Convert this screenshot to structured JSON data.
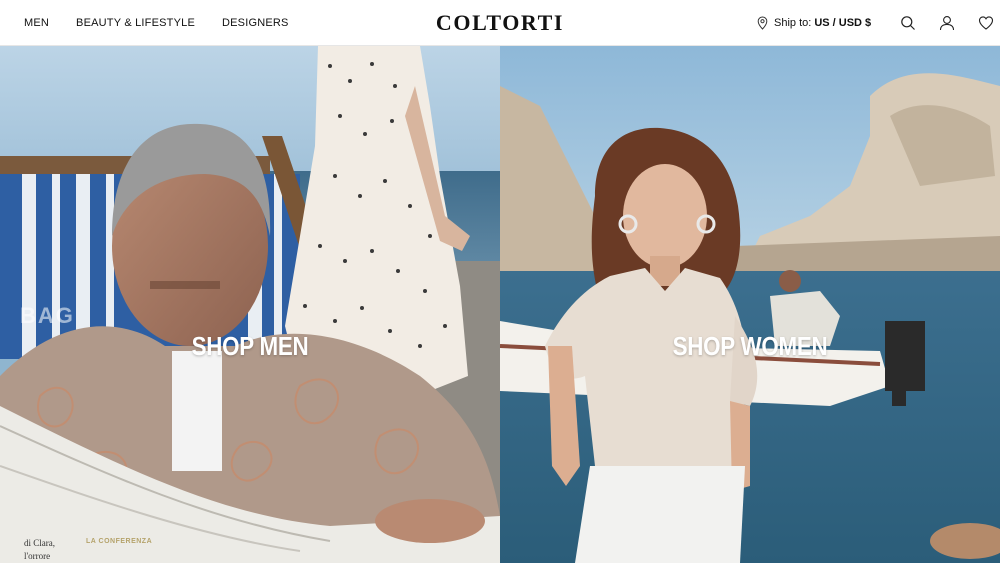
{
  "header": {
    "nav": [
      {
        "label": "MEN",
        "name": "nav-men"
      },
      {
        "label": "BEAUTY & LIFESTYLE",
        "name": "nav-beauty-lifestyle"
      },
      {
        "label": "DESIGNERS",
        "name": "nav-designers"
      }
    ],
    "logo": "COLTORTI",
    "ship_label": "Ship to:",
    "ship_value": "US / USD $",
    "icons": [
      "search-icon",
      "user-icon",
      "heart-icon"
    ]
  },
  "hero": {
    "men_cta": "SHOP MEN",
    "women_cta": "SHOP WOMEN",
    "men_bg_word": "BAG",
    "paper_line1": "di Clara,",
    "paper_line2": "l'orrore",
    "paper_head": "LA CONFERENZA"
  },
  "colors": {
    "sky": "#a9c8de",
    "sea": "#3f6f8c",
    "shirt": "#b39a88",
    "women_top": "#e7ddd2"
  }
}
